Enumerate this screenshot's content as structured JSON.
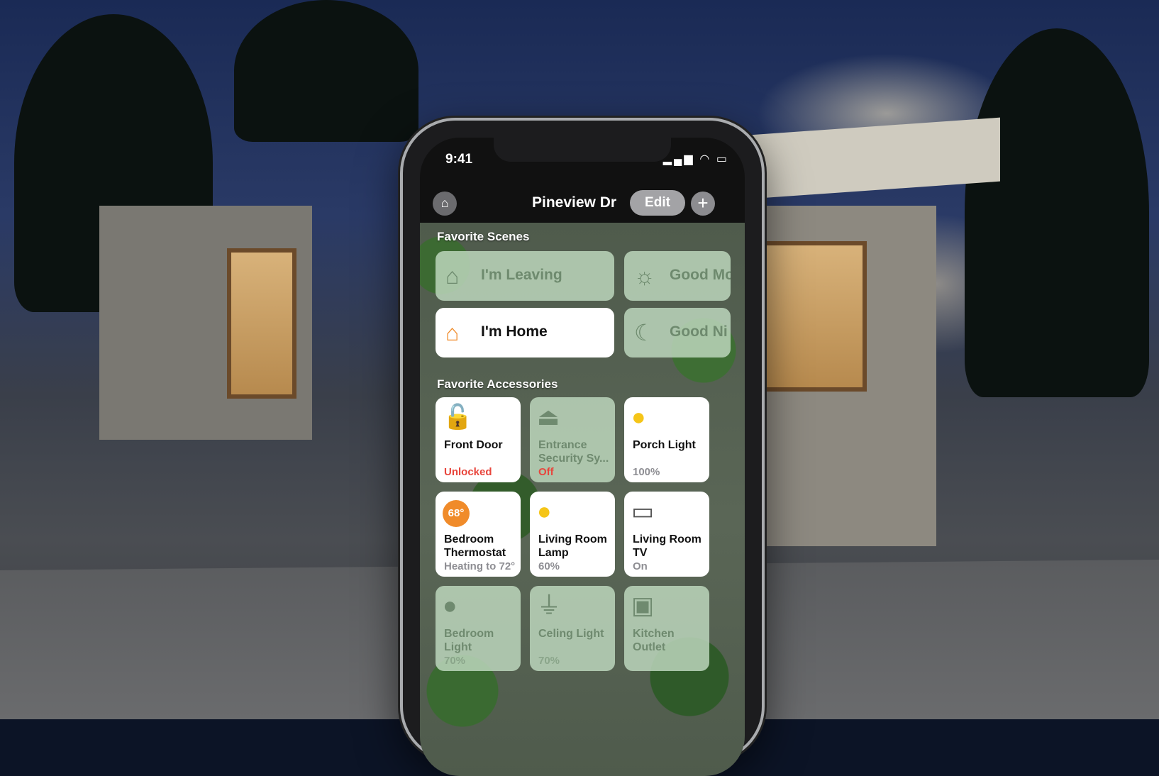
{
  "colors": {
    "accent_orange": "#f08b2a",
    "status_red": "#e8453c",
    "tile_inactive": "#bcd6bc",
    "tile_active": "#ffffff"
  },
  "status_bar": {
    "time": "9:41",
    "icons": "signal wifi battery"
  },
  "nav": {
    "home_icon": "house-icon",
    "title": "Pineview Dr",
    "edit_label": "Edit",
    "add_label": "+"
  },
  "favorite_scenes": {
    "heading": "Favorite Scenes",
    "items": [
      {
        "label": "I'm Leaving",
        "icon": "leaving-home-icon",
        "active": false
      },
      {
        "label": "Good Mo",
        "icon": "sunrise-home-icon",
        "active": false
      },
      {
        "label": "I'm Home",
        "icon": "arriving-home-icon",
        "active": true
      },
      {
        "label": "Good Ni",
        "icon": "night-home-icon",
        "active": false
      }
    ]
  },
  "favorite_accessories": {
    "heading": "Favorite Accessories",
    "items": [
      {
        "name": "Front Door",
        "status": "Unlocked",
        "icon": "unlocked-lock-icon",
        "active": true
      },
      {
        "name": "Entrance Security Sy...",
        "status": "Off",
        "icon": "alarm-icon",
        "active": false
      },
      {
        "name": "Porch Light",
        "status": "100%",
        "icon": "lightbulb-icon",
        "active": true
      },
      {
        "name": "Bedroom Thermostat",
        "status": "Heating to 72°",
        "badge": "68°",
        "icon": "thermostat-icon",
        "active": true
      },
      {
        "name": "Living Room Lamp",
        "status": "60%",
        "icon": "lightbulb-icon",
        "active": true
      },
      {
        "name": "Living Room TV",
        "status": "On",
        "icon": "tv-icon",
        "active": true
      },
      {
        "name": "Bedroom Light",
        "status": "70%",
        "icon": "lightbulb-icon",
        "active": false
      },
      {
        "name": "Celing Light",
        "status": "70%",
        "icon": "ceiling-lamp-icon",
        "active": false
      },
      {
        "name": "Kitchen Outlet",
        "status": "",
        "icon": "outlet-icon",
        "active": false
      }
    ]
  }
}
